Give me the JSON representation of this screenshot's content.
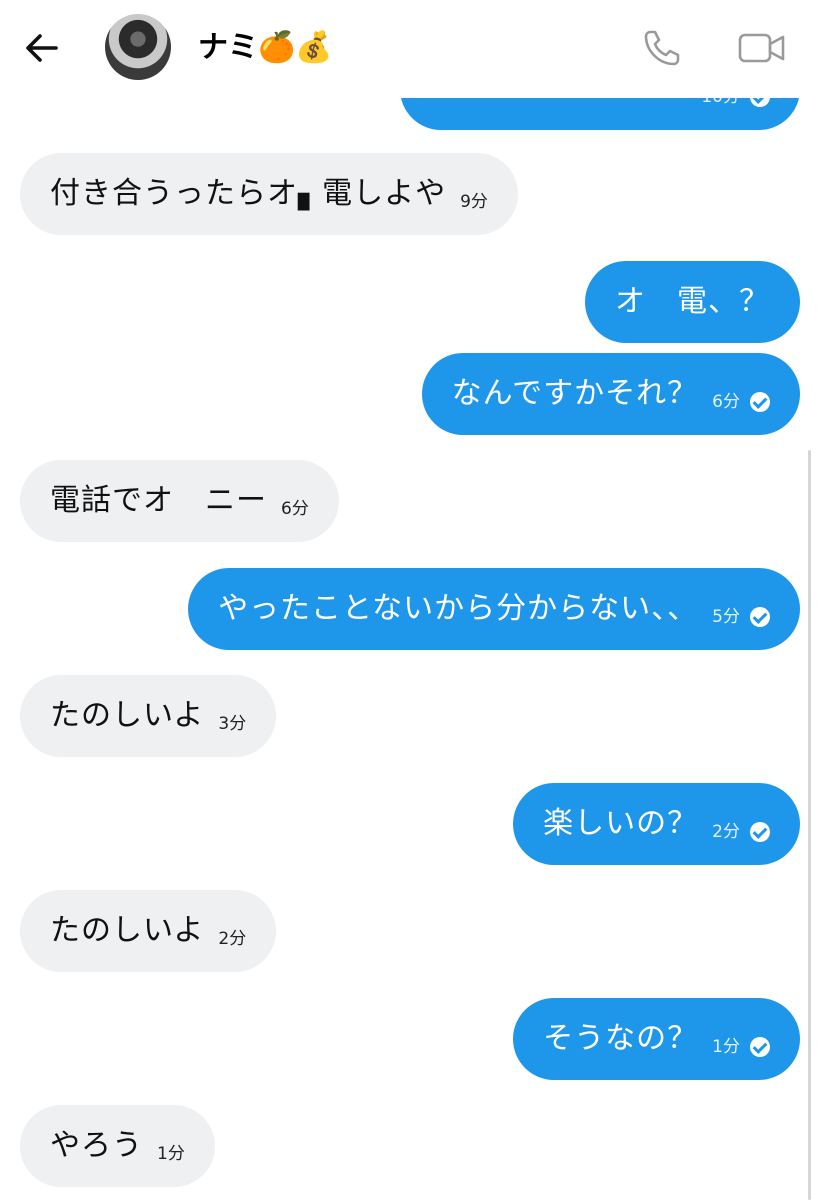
{
  "header": {
    "contact_name": "ナミ🍊💰",
    "back_icon": "arrow-left-icon",
    "call_icon": "phone-icon",
    "video_icon": "video-camera-icon"
  },
  "colors": {
    "outgoing_bubble": "#1e96ea",
    "incoming_bubble": "#eef0f2",
    "background": "#ffffff"
  },
  "messages": [
    {
      "direction": "out",
      "text": "",
      "time": "10分",
      "read": true,
      "partial": true
    },
    {
      "direction": "in",
      "text": "付き合うったらオ▖電しよや",
      "time": "9分"
    },
    {
      "direction": "out",
      "text": "オ　電、？",
      "time": ""
    },
    {
      "direction": "out",
      "text": "なんですかそれ？",
      "time": "6分",
      "read": true
    },
    {
      "direction": "in",
      "text": "電話でオ　ニー",
      "time": "6分"
    },
    {
      "direction": "out",
      "text": "やったことないから分からない、、",
      "time": "5分",
      "read": true
    },
    {
      "direction": "in",
      "text": "たのしいよ",
      "time": "3分"
    },
    {
      "direction": "out",
      "text": "楽しいの？",
      "time": "2分",
      "read": true
    },
    {
      "direction": "in",
      "text": "たのしいよ",
      "time": "2分"
    },
    {
      "direction": "out",
      "text": "そうなの？",
      "time": "1分",
      "read": true
    },
    {
      "direction": "in",
      "text": "やろう",
      "time": "1分"
    }
  ]
}
